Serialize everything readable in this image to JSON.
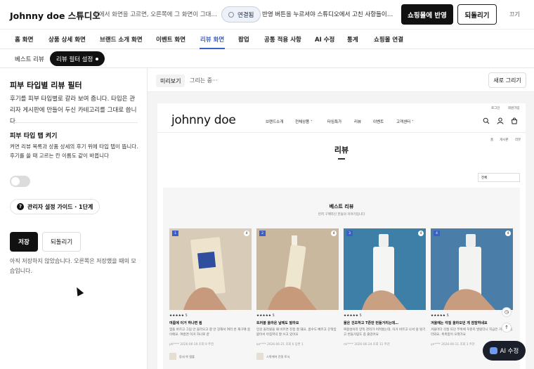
{
  "header": {
    "brand": "Johnny doe 스튜디오",
    "hint": "위에서 화면을 고르면, 오른쪽에 그 화면이 그대로 보여요",
    "connected": "연결됨",
    "publish_note": "반영 버튼을 누르셔야 스튜디오에서 고친 사항들이 실제로 적용돼요",
    "apply": "쇼핑몰에 반영",
    "revert": "되돌리기",
    "close": "끄기"
  },
  "nav": {
    "active": "리뷰 화면",
    "tabs": [
      {
        "label": "홈 화면"
      },
      {
        "label": "상품 상세 화면"
      },
      {
        "label": "브랜드 소개 화면"
      },
      {
        "label": "이벤트 화면"
      },
      {
        "label": "리뷰 화면"
      },
      {
        "label": "팝업"
      },
      {
        "label": "공통 적용 사항"
      },
      {
        "label": "AI 수정"
      },
      {
        "label": "통계"
      },
      {
        "label": "쇼핑몰 연결"
      }
    ]
  },
  "subtabs": {
    "items": [
      {
        "label": "베스트 리뷰"
      },
      {
        "label": "리뷰 필터 설정"
      }
    ]
  },
  "panel": {
    "title": "피부 타입별 리뷰 필터",
    "desc": "후기를 피부 타입별로 갈라 보여 줍니다. 타입은 관리자 게시판에 만들어 두신 카테고리를 그대로 씁니다.",
    "toggle_title": "피부 타입 탭 켜기",
    "toggle_desc": "켜면 리뷰 목록과 상품 상세의 후기 위에 타입 탭이 뜹니다. 후기를 쓸 때 고르는 칸 이름도 같이 바뀝니다",
    "toggle_on": false,
    "guide": "관리자 설정 가이드 · 1단계",
    "save": "저장",
    "undo": "되돌리기",
    "status": "아직 저장하지 않았습니다. 오른쪽은 저장했을 때의 모습입니다."
  },
  "preview": {
    "tab": "미리보기",
    "drawing": "그리는 중···",
    "redraw": "새로 그리기"
  },
  "site": {
    "util": [
      "로그인",
      "회원가입"
    ],
    "logo": "johnny  doe",
    "menu": [
      "브랜드소개",
      "전체상품 ˅",
      "타임특가",
      "리뷰",
      "이벤트",
      "고객센터 ˅"
    ],
    "crumb": [
      "홈",
      "게시판",
      "리뷰"
    ],
    "title": "리뷰",
    "sort": "전체",
    "best_title": "베스트 리뷰",
    "best_sub": "먼저 구매하신 분들의 이야기입니다",
    "cards": [
      {
        "rank": "1",
        "stars": "★★★★★ 5",
        "title": "여름에 이거 하나면 됨",
        "body": "앰플 바르고 그림 안 올라오고 향 안 강해서 여러 번 재구매 중이에요. 여름엔 이거 하나로 끝",
        "meta": "ph****  2026-06-19  조회 9  추천",
        "prod": "동네 약 앰플"
      },
      {
        "rank": "2",
        "stars": "★★★★★ 5",
        "title": "트러블 올라온 날에도 발라요",
        "body": "민감 올라왔을 때 바르면 진정 잘 돼요. 흡수도 빠르고 끈적임 없어서 아침저녁 잘 쓰고 있어요",
        "meta": "ka****  2026-06-21  조회 6  답변 1",
        "prod": "스팟케어 진정 토닉"
      },
      {
        "rank": "3",
        "stars": "★★★★★ 5",
        "title": "물은 건조하고 T존만 번들거리는데…",
        "body": "복합성이라 양쪽 관리가 어려웠는데, 이거 바르고 나서 덜 땅기고 번들거림도 좀 줄었어요",
        "meta": "mi****  2026-06-24  조회 11  추천",
        "prod": ""
      },
      {
        "rank": "4",
        "stars": "★★★★★ 5",
        "title": "겨울에는 각질 올라오던 게 잠잠하네요",
        "body": "겨울마다 각질 뜨던 부위에 꾸준히 발랐더니 지금은 거의 안 올라와요. 촉촉함이 오래가요",
        "meta": "ye****  2026-06-11  조회 3  추천",
        "prod": ""
      }
    ]
  },
  "ai_button": "AI 수정"
}
